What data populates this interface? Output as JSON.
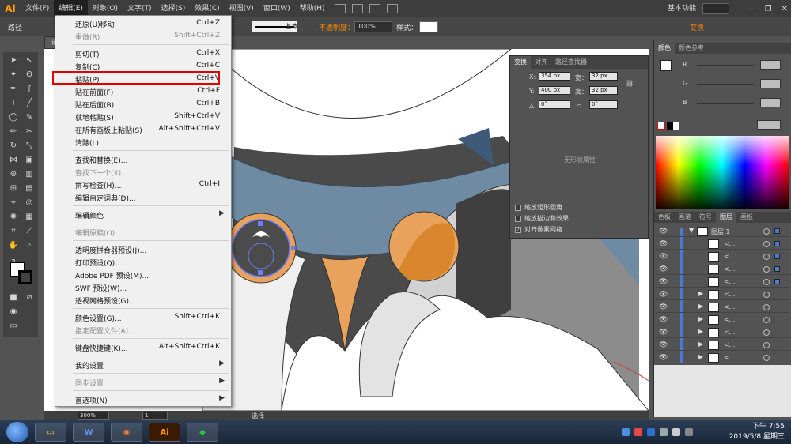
{
  "app": {
    "logo": "Ai"
  },
  "menubar": {
    "items": [
      "文件(F)",
      "编辑(E)",
      "对象(O)",
      "文字(T)",
      "选择(S)",
      "效果(C)",
      "视图(V)",
      "窗口(W)",
      "帮助(H)"
    ],
    "workspace": "基本功能",
    "icons": [
      "bridge-icon",
      "stock-icon",
      "arrange-icon",
      "gpu-icon"
    ]
  },
  "controlbar": {
    "path_label": "路径",
    "stroke_style": "基本",
    "opacity_label": "不透明度：",
    "opacity_value": "100%",
    "style_label": "样式：",
    "transform_label": "变换"
  },
  "doc_tab": {
    "label": "嵌"
  },
  "edit_menu": {
    "items": [
      {
        "label": "还原(U)移动",
        "shortcut": "Ctrl+Z",
        "disabled": false
      },
      {
        "label": "重做(R)",
        "shortcut": "Shift+Ctrl+Z",
        "disabled": true
      },
      {
        "label": "剪切(T)",
        "shortcut": "Ctrl+X",
        "disabled": false
      },
      {
        "label": "复制(C)",
        "shortcut": "Ctrl+C",
        "disabled": false
      },
      {
        "label": "粘贴(P)",
        "shortcut": "Ctrl+V",
        "disabled": false
      },
      {
        "label": "贴在前面(F)",
        "shortcut": "Ctrl+F",
        "disabled": false
      },
      {
        "label": "贴在后面(B)",
        "shortcut": "Ctrl+B",
        "disabled": false
      },
      {
        "label": "就地粘贴(S)",
        "shortcut": "Shift+Ctrl+V",
        "disabled": false
      },
      {
        "label": "在所有画板上粘贴(S)",
        "shortcut": "Alt+Shift+Ctrl+V",
        "disabled": false
      },
      {
        "label": "清除(L)",
        "shortcut": "",
        "disabled": false
      },
      {
        "label": "查找和替换(E)...",
        "shortcut": "",
        "disabled": false
      },
      {
        "label": "查找下一个(X)",
        "shortcut": "",
        "disabled": true
      },
      {
        "label": "拼写检查(H)...",
        "shortcut": "Ctrl+I",
        "disabled": false
      },
      {
        "label": "编辑自定词典(D)...",
        "shortcut": "",
        "disabled": false
      },
      {
        "label": "编辑颜色",
        "shortcut": "",
        "disabled": false,
        "submenu": true
      },
      {
        "label": "编辑原稿(O)",
        "shortcut": "",
        "disabled": true
      },
      {
        "label": "透明度拼合器预设(J)...",
        "shortcut": "",
        "disabled": false
      },
      {
        "label": "打印预设(Q)...",
        "shortcut": "",
        "disabled": false
      },
      {
        "label": "Adobe PDF 预设(M)...",
        "shortcut": "",
        "disabled": false
      },
      {
        "label": "SWF 预设(W)...",
        "shortcut": "",
        "disabled": false
      },
      {
        "label": "透视网格预设(G)...",
        "shortcut": "",
        "disabled": false
      },
      {
        "label": "颜色设置(G)...",
        "shortcut": "Shift+Ctrl+K",
        "disabled": false
      },
      {
        "label": "指定配置文件(A)...",
        "shortcut": "",
        "disabled": true
      },
      {
        "label": "键盘快捷键(K)...",
        "shortcut": "Alt+Shift+Ctrl+K",
        "disabled": false
      },
      {
        "label": "我的设置",
        "shortcut": "",
        "disabled": false,
        "submenu": true
      },
      {
        "label": "同步设置",
        "shortcut": "",
        "disabled": true,
        "submenu": true
      },
      {
        "label": "首选项(N)",
        "shortcut": "",
        "disabled": false,
        "submenu": true
      }
    ],
    "highlighted": "粘贴(P)"
  },
  "transform_panel": {
    "tabs": [
      "变换",
      "对齐",
      "路径查找器"
    ],
    "x_label": "X:",
    "x_value": "354 px",
    "y_label": "Y:",
    "y_value": "400 px",
    "w_label": "宽：",
    "w_value": "32 px",
    "h_label": "高：",
    "h_value": "32 px",
    "rotate_value": "0°",
    "shear_value": "0°",
    "no_shape": "无形状属性",
    "options": [
      {
        "label": "缩放矩形圆角",
        "checked": false
      },
      {
        "label": "缩放描边和效果",
        "checked": false
      },
      {
        "label": "对齐像素网格",
        "checked": true
      }
    ]
  },
  "color_panel": {
    "tabs": [
      "颜色",
      "颜色参考"
    ],
    "channels": [
      "R",
      "G",
      "B"
    ]
  },
  "layers_panel": {
    "tabs": [
      "色板",
      "画笔",
      "符号",
      "图层",
      "画板"
    ],
    "layer_name": "图层 1",
    "sublayer_label": "<..."
  },
  "statusbar": {
    "zoom": "300%",
    "page": "1",
    "status": "选择"
  },
  "taskbar": {
    "apps": [
      "explorer-icon",
      "word-icon",
      "firefox-icon",
      "illustrator-icon",
      "green-app-icon"
    ],
    "time": "下午 7:55",
    "date": "2019/5/8 星期三"
  },
  "colors": {
    "menu_highlight_border": "#e00000",
    "accent_orange": "#ff8c00",
    "canvas_blue": "#6f8aa3",
    "canvas_orange": "#e9a25c"
  }
}
